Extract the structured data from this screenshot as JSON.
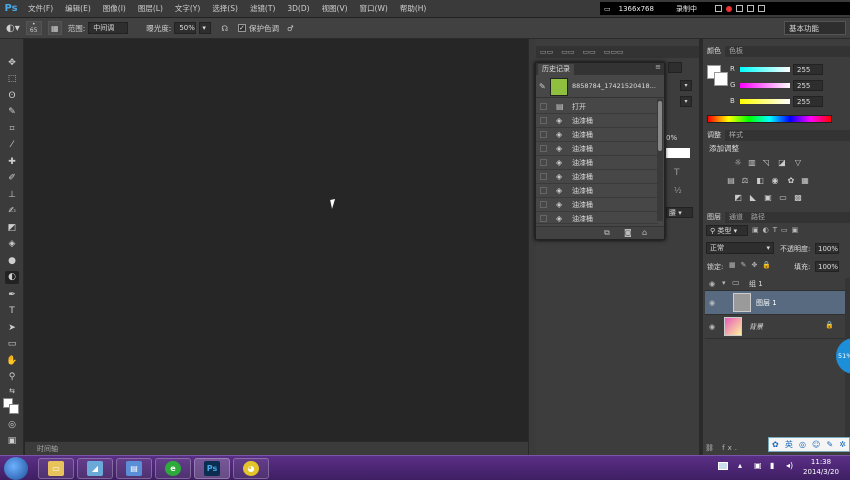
{
  "app": {
    "logo": "Ps"
  },
  "menu": [
    "文件(F)",
    "编辑(E)",
    "图像(I)",
    "图层(L)",
    "文字(Y)",
    "选择(S)",
    "滤镜(T)",
    "3D(D)",
    "视图(V)",
    "窗口(W)",
    "帮助(H)"
  ],
  "recorder": {
    "resolution": "1366x768",
    "status": "录制中"
  },
  "options": {
    "brush_size": "65",
    "range_label": "范围:",
    "range_value": "中间调",
    "exposure_label": "曝光度:",
    "exposure_value": "50%",
    "protect_tones": "保护色调",
    "workspace": "基本功能"
  },
  "timeline": {
    "label": "时间轴"
  },
  "history": {
    "tab": "历史记录",
    "snapshot": "8858784_17421520418...",
    "rows": [
      "打开",
      "油漆桶",
      "油漆桶",
      "油漆桶",
      "油漆桶",
      "油漆桶",
      "油漆桶",
      "油漆桶",
      "油漆桶"
    ]
  },
  "mid_panel": {
    "opacity_fragment": "0%",
    "fragment_value": "腰"
  },
  "color": {
    "tabs": [
      "颜色",
      "色板"
    ],
    "r": {
      "label": "R",
      "value": "255"
    },
    "g": {
      "label": "G",
      "value": "255"
    },
    "b": {
      "label": "B",
      "value": "255"
    }
  },
  "adjust": {
    "tabs": [
      "调整",
      "样式"
    ],
    "title": "添加调整"
  },
  "layers": {
    "tabs": [
      "图层",
      "通道",
      "路径"
    ],
    "kind": "类型",
    "blend": "正常",
    "opacity_label": "不透明度:",
    "opacity": "100%",
    "lock_label": "锁定:",
    "fill_label": "填充:",
    "fill": "100%",
    "items": [
      {
        "name": "组 1"
      },
      {
        "name": "图层 1"
      },
      {
        "name": "背景"
      }
    ]
  },
  "badge": "51%",
  "ime": [
    "英"
  ],
  "clock": {
    "time": "11:38",
    "date": "2014/3/20"
  },
  "colors": {
    "accent": "#4aa8e8",
    "taskbar": "#4a2570"
  }
}
